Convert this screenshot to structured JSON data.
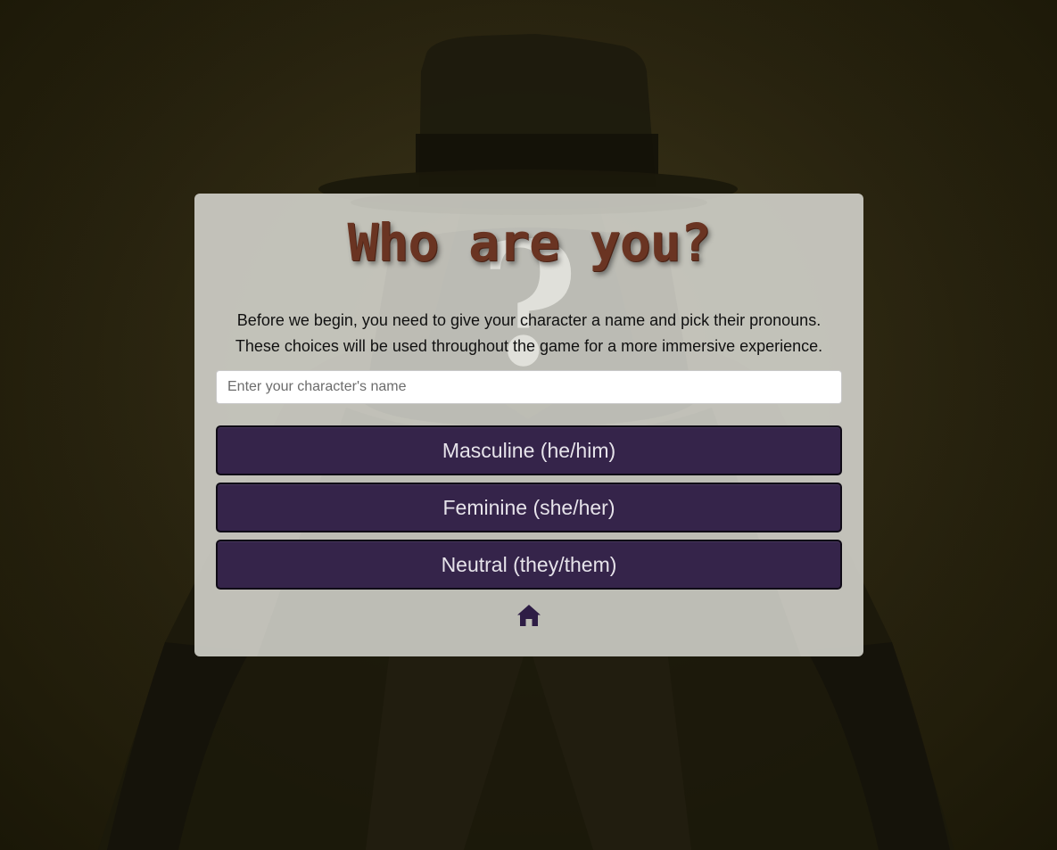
{
  "character_setup": {
    "title": "Who are you?",
    "intro_line_1": "Before we begin, you need to give your character a name and pick their pronouns.",
    "intro_line_2": "These choices will be used throughout the game for a more immersive experience.",
    "name_input": {
      "placeholder": "Enter your character's name",
      "value": ""
    },
    "pronoun_options": [
      {
        "label": "Masculine (he/him)"
      },
      {
        "label": "Feminine (she/her)"
      },
      {
        "label": "Neutral (they/them)"
      }
    ],
    "home_icon": "home-icon"
  },
  "background": {
    "icon": "detective-silhouette"
  },
  "colors": {
    "button_bg": "#35244a",
    "button_text": "#e6e3ea",
    "title": "#6a3422",
    "home_icon": "#2e1d45"
  }
}
